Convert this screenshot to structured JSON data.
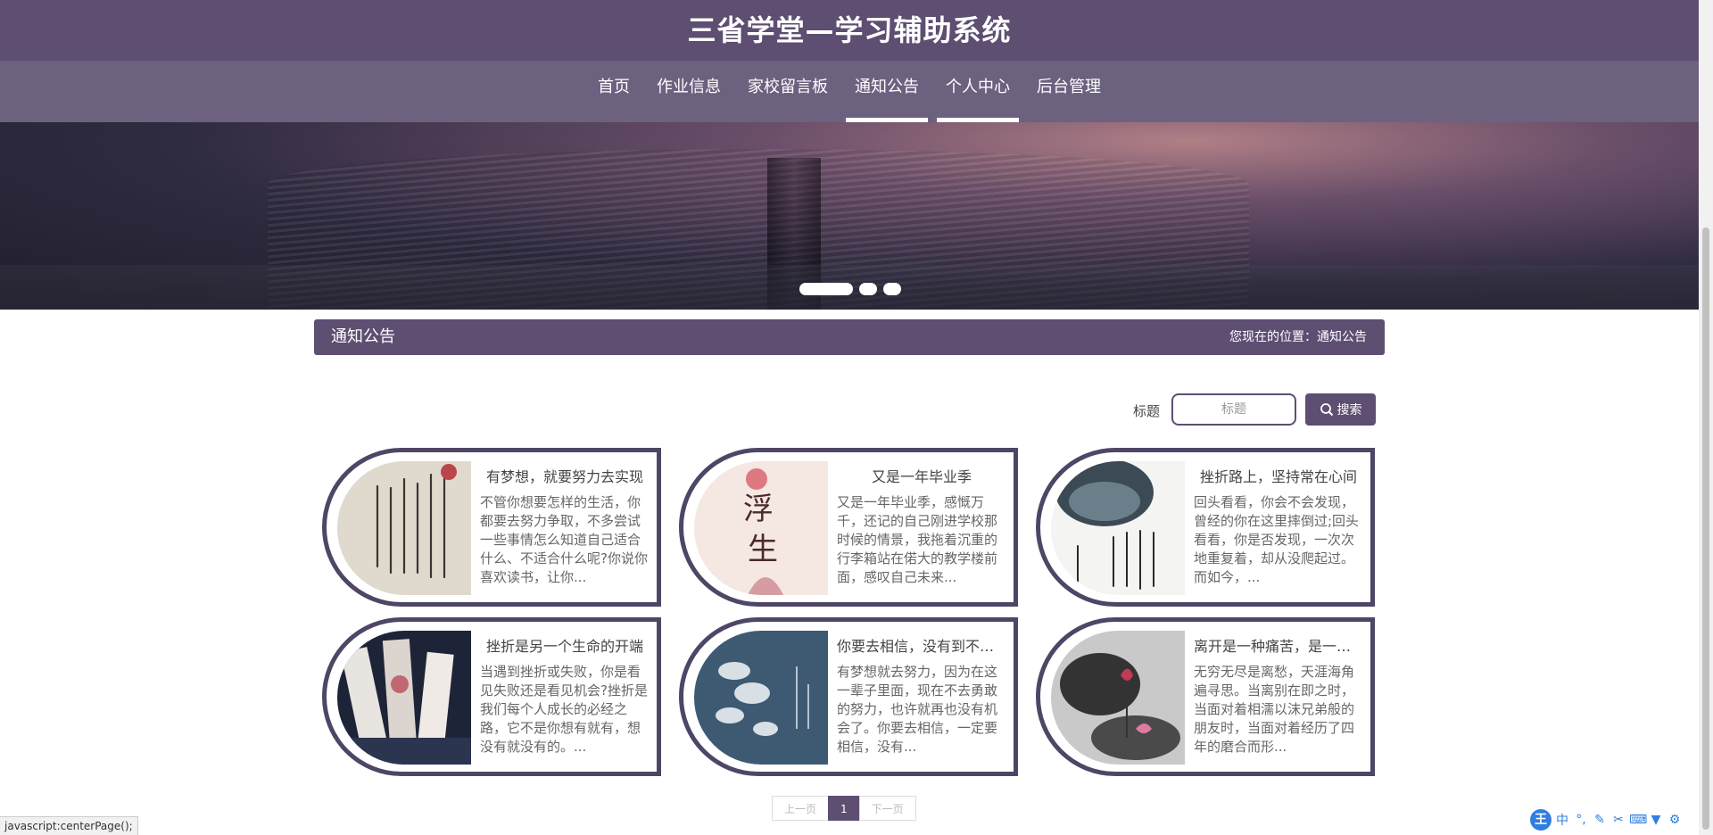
{
  "header": {
    "site_title": "三省学堂—学习辅助系统"
  },
  "nav": {
    "items": [
      {
        "label": "首页"
      },
      {
        "label": "作业信息"
      },
      {
        "label": "家校留言板"
      },
      {
        "label": "通知公告"
      },
      {
        "label": "个人中心"
      },
      {
        "label": "后台管理"
      }
    ],
    "active": [
      "通知公告",
      "个人中心"
    ]
  },
  "banner": {
    "slides": 3,
    "active_slide": 1
  },
  "section": {
    "title": "通知公告",
    "location": "您现在的位置：通知公告"
  },
  "search": {
    "label": "标题",
    "placeholder": "标题",
    "value": "",
    "button_label": "搜索"
  },
  "cards": [
    {
      "title": "有梦想，就要努力去实现",
      "desc": "不管你想要怎样的生活，你都要去努力争取，不多尝试一些事情怎么知道自己适合什么、不适合什么呢?你说你喜欢读书，让你..."
    },
    {
      "title": "又是一年毕业季",
      "desc": "又是一年毕业季，感慨万千，还记的自己刚进学校那时候的情景，我拖着沉重的行李箱站在偌大的教学楼前面，感叹自己未来..."
    },
    {
      "title": "挫折路上，坚持常在心间",
      "desc": "回头看看，你会不会发现，曾经的你在这里摔倒过;回头看看，你是否发现，一次次地重复着，却从没爬起过。而如今，..."
    },
    {
      "title": "挫折是另一个生命的开端",
      "desc": "当遇到挫折或失败，你是看见失败还是看见机会?挫折是我们每个人成长的必经之路，它不是你想有就有，想没有就没有的。..."
    },
    {
      "title": "你要去相信，没有到不了的明天",
      "desc": "有梦想就去努力，因为在这一辈子里面，现在不去勇敢的努力，也许就再也没有机会了。你要去相信，一定要相信，没有..."
    },
    {
      "title": "离开是一种痛苦，是一种考验",
      "desc": "无穷无尽是离愁，天涯海角遍寻思。当离别在即之时，当面对着相濡以沫兄弟般的朋友时，当面对着经历了四年的磨合而形..."
    }
  ],
  "pagination": {
    "prev": "上一页",
    "current": "1",
    "next": "下一页"
  },
  "status_bar": {
    "text": "javascript:centerPage();"
  },
  "ime": {
    "badge": "王",
    "mode": "中"
  },
  "colors": {
    "primary": "#5e4e72",
    "nav": "#6d6180",
    "card_border": "#4e4666"
  }
}
